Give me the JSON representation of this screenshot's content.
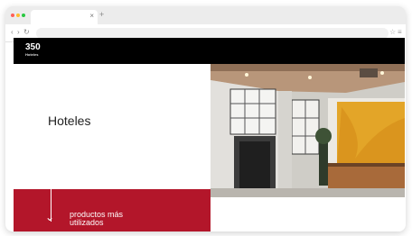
{
  "browser": {
    "tab_close": "×",
    "new_tab": "+",
    "nav": {
      "back": "‹",
      "forward": "›",
      "reload": "↻",
      "home": "⌂"
    },
    "right_icons": {
      "star": "☆",
      "menu": "≡"
    },
    "traffic_colors": [
      "#ff5f57",
      "#febc2e",
      "#28c840"
    ]
  },
  "site": {
    "logo": {
      "main": "350",
      "sub": "Hoteles"
    },
    "nav_items": [
      "",
      "",
      "",
      "",
      ""
    ],
    "section": {
      "eyebrow": "",
      "title": "Hoteles",
      "paragraph": ""
    },
    "cta": {
      "line1": "productos más",
      "line2": "utilizados"
    },
    "brand_color": "#b3162a"
  }
}
